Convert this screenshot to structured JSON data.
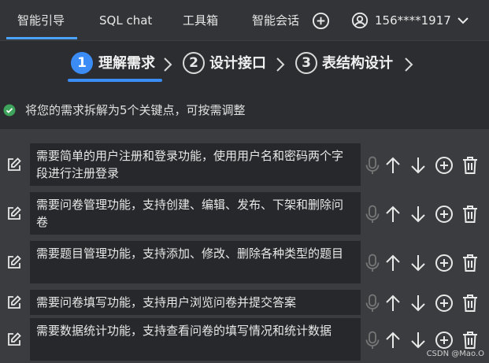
{
  "nav": {
    "tabs": [
      {
        "label": "智能引导"
      },
      {
        "label": "SQL chat"
      },
      {
        "label": "工具箱"
      },
      {
        "label": "智能会话"
      }
    ],
    "user_phone": "156****1917"
  },
  "steps": [
    {
      "num": "1",
      "label": "理解需求"
    },
    {
      "num": "2",
      "label": "设计接口"
    },
    {
      "num": "3",
      "label": "表结构设计"
    }
  ],
  "status": {
    "text": "将您的需求拆解为5个关键点，可按需调整"
  },
  "requirements": [
    {
      "text": "需要简单的用户注册和登录功能，使用用户名和密码两个字段进行注册登录"
    },
    {
      "text": "需要问卷管理功能，支持创建、编辑、发布、下架和删除问卷"
    },
    {
      "text": "需要题目管理功能，支持添加、修改、删除各种类型的题目"
    },
    {
      "text": "需要问卷填写功能，支持用户浏览问卷并提交答案"
    },
    {
      "text": "需要数据统计功能，支持查看问卷的填写情况和统计数据"
    }
  ],
  "watermark": "CSDN @Mao.O",
  "colors": {
    "accent": "#3b8cf5",
    "success": "#3fa45b",
    "panel": "#3a3c3f",
    "box": "#26282b"
  }
}
